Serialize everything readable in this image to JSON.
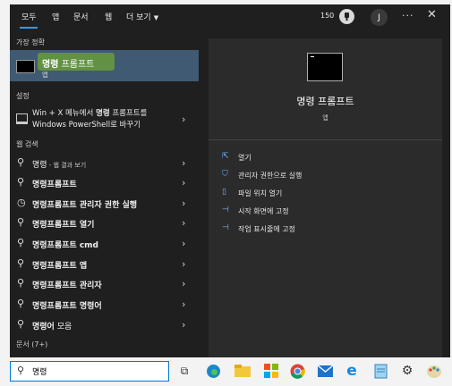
{
  "tabs": [
    {
      "label": "모두"
    },
    {
      "label": "앱"
    },
    {
      "label": "문서"
    },
    {
      "label": "웹"
    },
    {
      "label": "더 보기"
    }
  ],
  "header": {
    "points": "150",
    "avatar_initial": "J",
    "more": "···",
    "close": "✕"
  },
  "left": {
    "best_match_title": "가장 정확",
    "best_match": {
      "name_bold": "명령",
      "name_rest": " 프롬프트",
      "type": "앱"
    },
    "settings_title": "설정",
    "setting": {
      "line1_pre": "Win + X 메뉴에서 ",
      "line1_bold": "명령",
      "line1_post": " 프롬프트를",
      "line2": "Windows PowerShell로 바꾸기"
    },
    "apps_title": "웹 검색",
    "items": [
      {
        "bold": "명령",
        "rest": "",
        "sub": " - 웹 결과 보기",
        "icon": "search-icon"
      },
      {
        "bold": "명령프롬프트",
        "rest": "",
        "sub": "",
        "icon": "search-icon"
      },
      {
        "bold": "명령프롬프트 관리자 권한 실행",
        "rest": "",
        "sub": "",
        "icon": "history-icon"
      },
      {
        "bold": "명령프롬프트 열기",
        "rest": "",
        "sub": "",
        "icon": "search-icon"
      },
      {
        "bold": "명령프롬프트 cmd",
        "rest": "",
        "sub": "",
        "icon": "search-icon"
      },
      {
        "bold": "명령프롬프트 앱",
        "rest": "",
        "sub": "",
        "icon": "search-icon"
      },
      {
        "bold": "명령프롬프트 관리자",
        "rest": "",
        "sub": "",
        "icon": "search-icon"
      },
      {
        "bold": "명령프롬프트 명령어",
        "rest": "",
        "sub": "",
        "icon": "search-icon"
      },
      {
        "bold": "명령어",
        "rest": " 모음",
        "sub": "",
        "icon": "search-icon"
      }
    ],
    "docs_title": "문서 (7+)"
  },
  "right": {
    "title": "명령 프롬프트",
    "subtitle": "앱",
    "actions": [
      {
        "label": "열기",
        "icon": "open-icon"
      },
      {
        "label": "관리자 권한으로 실행",
        "icon": "shield-icon"
      },
      {
        "label": "파일 위치 열기",
        "icon": "folder-icon"
      },
      {
        "label": "시작 화면에 고정",
        "icon": "pin-icon"
      },
      {
        "label": "작업 표시줄에 고정",
        "icon": "pin-icon"
      }
    ]
  },
  "taskbar": {
    "search_value": "명령",
    "icons": [
      "task-view-icon",
      "edge-icon",
      "file-explorer-icon",
      "store-icon",
      "chrome-icon",
      "mail-icon",
      "ie-icon",
      "notepad-icon",
      "settings-icon",
      "paint-icon"
    ]
  }
}
